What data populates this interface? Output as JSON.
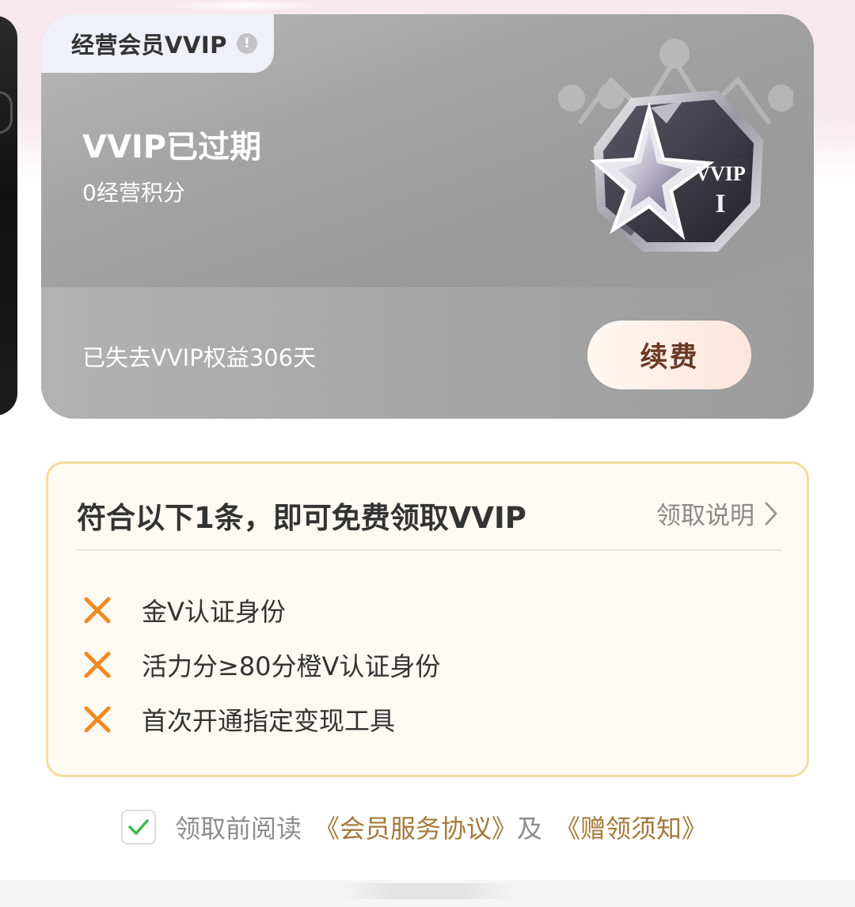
{
  "card": {
    "tag_label": "经营会员VVIP",
    "tag_info_glyph": "!",
    "status": "VVIP已过期",
    "points": "0经营积分",
    "lost_benefits": "已失去VVIP权益306天",
    "renew_label": "续费",
    "badge_text": "VVIP",
    "badge_level": "I"
  },
  "eligibility": {
    "title": "符合以下1条，即可免费领取VVIP",
    "info_link": "领取说明",
    "conditions": [
      {
        "label": "金V认证身份",
        "met": false
      },
      {
        "label": "活力分≥80分橙V认证身份",
        "met": false
      },
      {
        "label": "首次开通指定变现工具",
        "met": false
      }
    ],
    "unmet_color": "#f08a24"
  },
  "agreement": {
    "checked": true,
    "prefix": "领取前阅读",
    "doc1": "《会员服务协议》",
    "joiner": "及",
    "doc2": "《赠领须知》",
    "check_color": "#3cb84a",
    "link_color": "#a37a3a"
  }
}
